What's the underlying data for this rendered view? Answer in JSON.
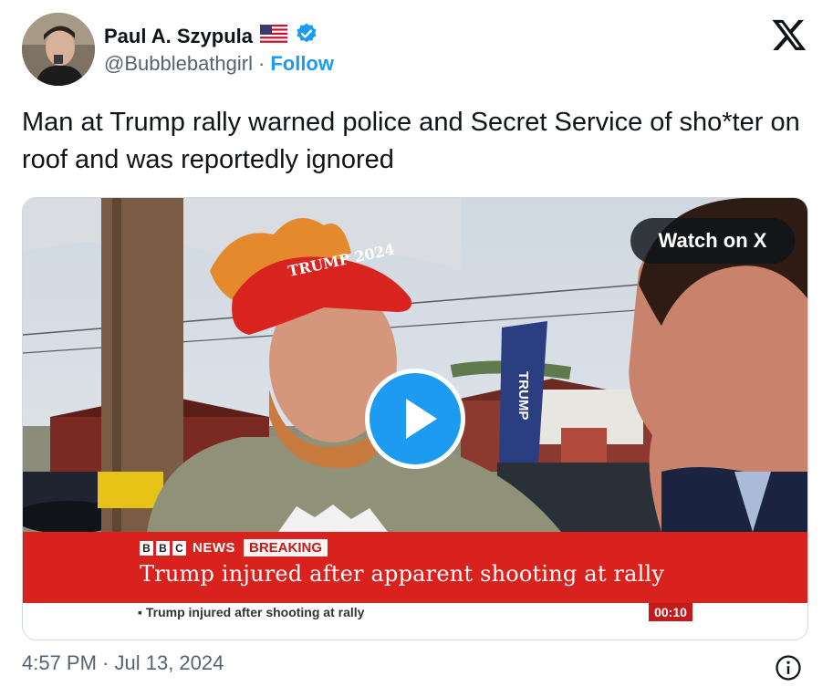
{
  "author": {
    "name": "Paul A. Szypula",
    "flag_icon": "us-flag-icon",
    "verified_icon": "verified-badge-icon",
    "handle": "@Bubblebathgirl",
    "separator": "·",
    "follow_label": "Follow"
  },
  "platform_icon": "x-logo-icon",
  "tweet": {
    "text": "Man at Trump rally warned police and Secret Service of sho*ter on roof and was reportedly ignored"
  },
  "media": {
    "watch_label": "Watch on X",
    "play_icon": "play-icon",
    "cap_text": "TRUMP 2024",
    "banner_text": "TRUMP",
    "bbc_letters": [
      "B",
      "B",
      "C"
    ],
    "news_label": "NEWS",
    "breaking_label": "BREAKING",
    "headline": "Trump injured after apparent shooting at rally",
    "ticker": "▪ Trump injured after shooting at rally",
    "clock": "00:10"
  },
  "footer": {
    "timestamp": "4:57 PM · Jul 13, 2024",
    "info_icon": "info-icon"
  },
  "colors": {
    "accent": "#1d9bf0",
    "bbc_red": "#d9221d",
    "text_primary": "#0f1419",
    "text_secondary": "#536471"
  }
}
